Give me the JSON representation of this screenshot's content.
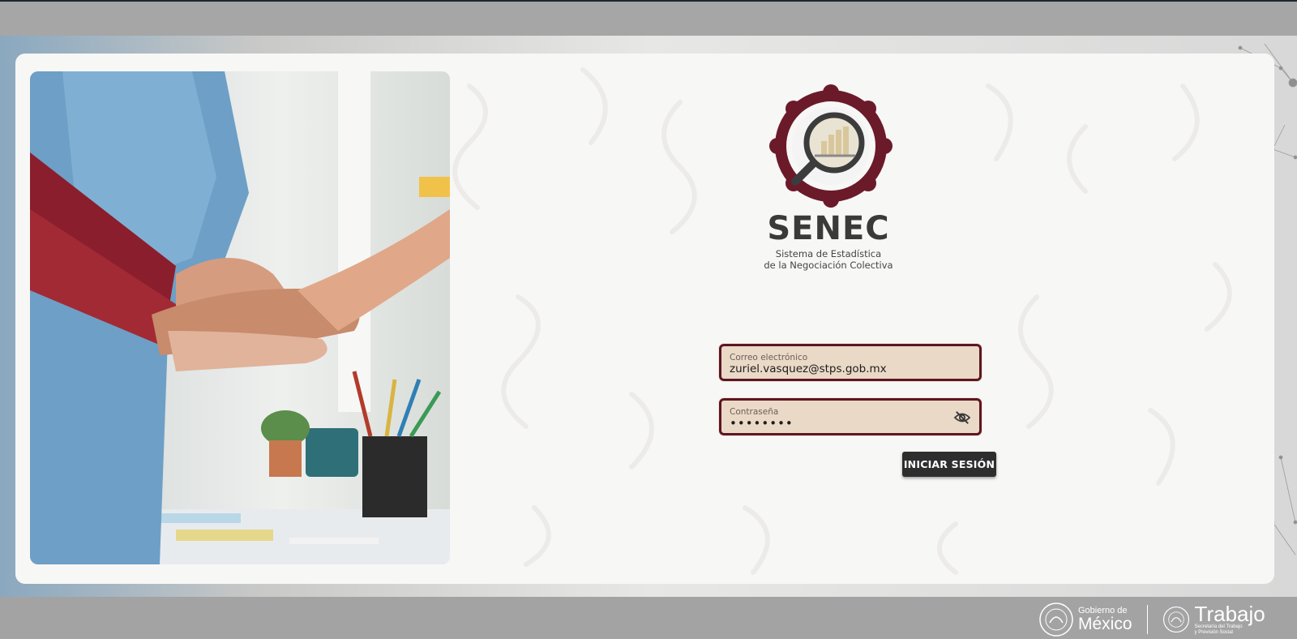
{
  "brand": {
    "name": "SENEC",
    "subtitle_line1": "Sistema de Estadística",
    "subtitle_line2": "de la Negociación Colectiva"
  },
  "form": {
    "email": {
      "label": "Correo electrónico",
      "value": "zuriel.vasquez@stps.gob.mx"
    },
    "password": {
      "label": "Contraseña",
      "masked_value": "••••••••",
      "toggle_icon": "eye-off-icon"
    },
    "submit_label": "INICIAR SESIÓN"
  },
  "footer": {
    "gobierno_small": "Gobierno de",
    "gobierno_big": "México",
    "trabajo_title": "Trabajo",
    "trabajo_sub1": "Secretaría del Trabajo",
    "trabajo_sub2": "y Previsión Social"
  },
  "colors": {
    "accent": "#5c1623",
    "field_bg": "#ead9c6",
    "button_bg": "#2e2e2e"
  }
}
